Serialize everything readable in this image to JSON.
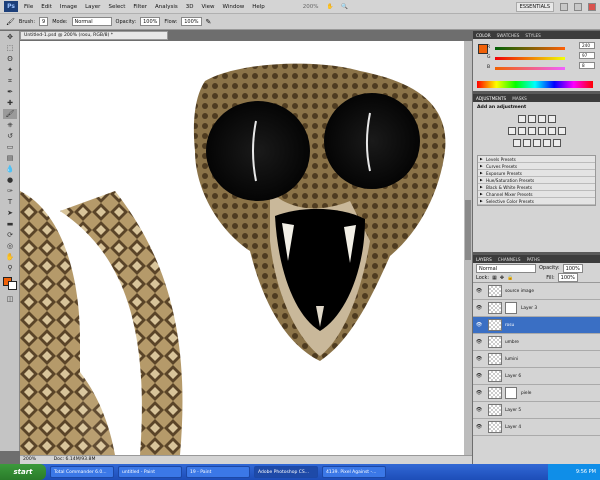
{
  "menubar": {
    "app_badge": "Ps",
    "items": [
      "File",
      "Edit",
      "Image",
      "Layer",
      "Select",
      "Filter",
      "Analysis",
      "3D",
      "View",
      "Window",
      "Help"
    ],
    "zoom": "200%",
    "workspace": "ESSENTIALS"
  },
  "options": {
    "brush_label": "Brush:",
    "brush_size": "9",
    "mode_label": "Mode:",
    "mode_value": "Normal",
    "opacity_label": "Opacity:",
    "opacity_value": "100%",
    "flow_label": "Flow:",
    "flow_value": "100%"
  },
  "document": {
    "tab_title": "Untitled-1.psd @ 200% (rosu, RGB/8) *",
    "status_zoom": "200%",
    "status_doc": "Doc: 6.14M/93.8M"
  },
  "color_panel": {
    "tabs": [
      "COLOR",
      "SWATCHES",
      "STYLES"
    ],
    "r_label": "R",
    "g_label": "G",
    "b_label": "B",
    "r": "240",
    "g": "97",
    "b": "8",
    "foreground_color": "#f06108"
  },
  "adjustments_panel": {
    "tabs": [
      "ADJUSTMENTS",
      "MASKS"
    ],
    "heading": "Add an adjustment",
    "presets": [
      "Levels Presets",
      "Curves Presets",
      "Exposure Presets",
      "Hue/Saturation Presets",
      "Black & White Presets",
      "Channel Mixer Presets",
      "Selective Color Presets"
    ]
  },
  "layers_panel": {
    "tabs": [
      "LAYERS",
      "CHANNELS",
      "PATHS"
    ],
    "blend_mode": "Normal",
    "opacity_label": "Opacity:",
    "opacity_value": "100%",
    "lock_label": "Lock:",
    "fill_label": "Fill:",
    "fill_value": "100%",
    "layers": [
      {
        "name": "source image",
        "selected": false,
        "mask": false
      },
      {
        "name": "Layer 3",
        "selected": false,
        "mask": true
      },
      {
        "name": "rosu",
        "selected": true,
        "mask": false
      },
      {
        "name": "umbre",
        "selected": false,
        "mask": false
      },
      {
        "name": "lumini",
        "selected": false,
        "mask": false
      },
      {
        "name": "Layer 6",
        "selected": false,
        "mask": false
      },
      {
        "name": "piele",
        "selected": false,
        "mask": true
      },
      {
        "name": "Layer 5",
        "selected": false,
        "mask": false
      },
      {
        "name": "Layer 4",
        "selected": false,
        "mask": false
      }
    ]
  },
  "taskbar": {
    "start": "start",
    "tasks": [
      "Total Commander 6.0...",
      "untitled - Paint",
      "19 - Paint",
      "Adobe Photoshop CS...",
      "4139. Pixel Against -..."
    ],
    "clock": "9:56 PM"
  }
}
